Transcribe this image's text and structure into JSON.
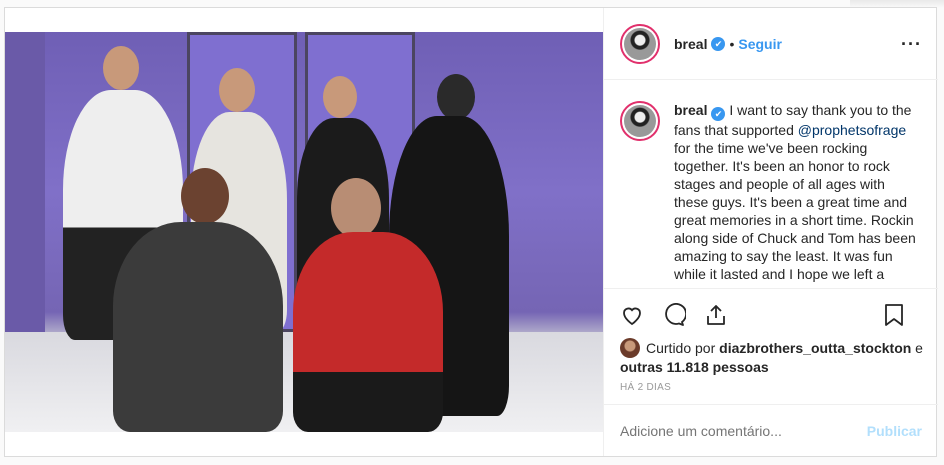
{
  "post": {
    "username": "breal",
    "follow_label": "Seguir",
    "caption_username": "breal",
    "caption_text_1": " I want to say thank you to the fans that supported ",
    "mention": "@prophetsofrage",
    "caption_text_2": " for the time we've been rocking together. It's been an honor to rock stages and people of all ages with these guys. It's been a great time and great memories in a short time. Rockin along side of Chuck and Tom has been amazing to say the least. It was fun while it lasted and I hope we left a",
    "liked_by_prefix": "Curtido por ",
    "liked_by_user": "diazbrothers_outta_stockton",
    "liked_by_and": " e",
    "liked_by_others": "outras 11.818 pessoas",
    "timestamp": "HÁ 2 DIAS",
    "comment_placeholder": "Adicione um comentário...",
    "publish_label": "Publicar"
  },
  "colors": {
    "accent": "#3897f0",
    "publish_disabled": "#b2dffc",
    "mention": "#003569"
  },
  "icons": [
    "heart-icon",
    "comment-icon",
    "share-icon",
    "bookmark-icon",
    "more-options-icon",
    "verified-badge-icon"
  ]
}
